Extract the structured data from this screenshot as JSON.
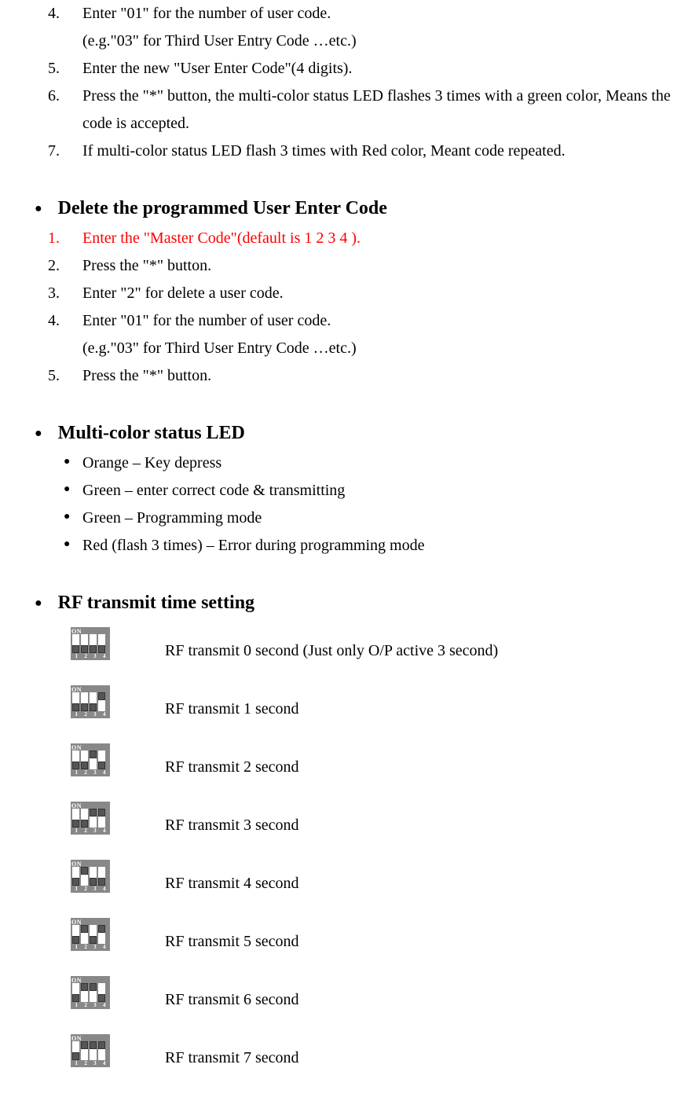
{
  "top_steps": [
    {
      "n": "4.",
      "lines": [
        "Enter \"01\" for the number of user code.",
        "(e.g.\"03\" for Third User Entry Code …etc.)"
      ]
    },
    {
      "n": "5.",
      "lines": [
        "Enter the new \"User Enter Code\"(4 digits)."
      ]
    },
    {
      "n": "6.",
      "lines": [
        "Press the \"*\" button, the multi-color status LED flashes 3 times with a green color, Means the code is accepted."
      ]
    },
    {
      "n": "7.",
      "lines": [
        "If multi-color status LED flash 3 times with Red color, Meant code repeated."
      ]
    }
  ],
  "delete": {
    "title": "Delete the programmed User Enter Code",
    "steps": [
      {
        "n": "1.",
        "lines": [
          "Enter the \"Master Code\"(default is 1 2 3 4 )."
        ],
        "red": true
      },
      {
        "n": "2.",
        "lines": [
          "Press the \"*\" button."
        ]
      },
      {
        "n": "3.",
        "lines": [
          "Enter \"2\" for delete a user code."
        ]
      },
      {
        "n": "4.",
        "lines": [
          "Enter \"01\" for the number of user code.",
          "(e.g.\"03\" for Third User Entry Code …etc.)"
        ]
      },
      {
        "n": "5.",
        "lines": [
          "Press the \"*\" button."
        ]
      }
    ]
  },
  "led": {
    "title": "Multi-color status LED",
    "items": [
      "Orange – Key depress",
      "Green – enter correct code & transmitting",
      "Green – Programming mode",
      "Red (flash 3 times) – Error during programming mode"
    ]
  },
  "rf": {
    "title": "RF transmit time setting",
    "rows": [
      {
        "dip": [
          "off",
          "off",
          "off",
          "off"
        ],
        "desc": "RF transmit 0 second (Just only O/P active 3 second)"
      },
      {
        "dip": [
          "off",
          "off",
          "off",
          "on"
        ],
        "desc": "RF transmit 1 second"
      },
      {
        "dip": [
          "off",
          "off",
          "on",
          "off"
        ],
        "desc": "RF transmit 2 second"
      },
      {
        "dip": [
          "off",
          "off",
          "on",
          "on"
        ],
        "desc": "RF transmit 3 second"
      },
      {
        "dip": [
          "off",
          "on",
          "off",
          "off"
        ],
        "desc": "RF transmit 4 second"
      },
      {
        "dip": [
          "off",
          "on",
          "off",
          "on"
        ],
        "desc": "RF transmit 5 second"
      },
      {
        "dip": [
          "off",
          "on",
          "on",
          "off"
        ],
        "desc": "RF transmit 6 second"
      },
      {
        "dip": [
          "off",
          "on",
          "on",
          "on"
        ],
        "desc": "RF transmit 7 second"
      }
    ]
  }
}
